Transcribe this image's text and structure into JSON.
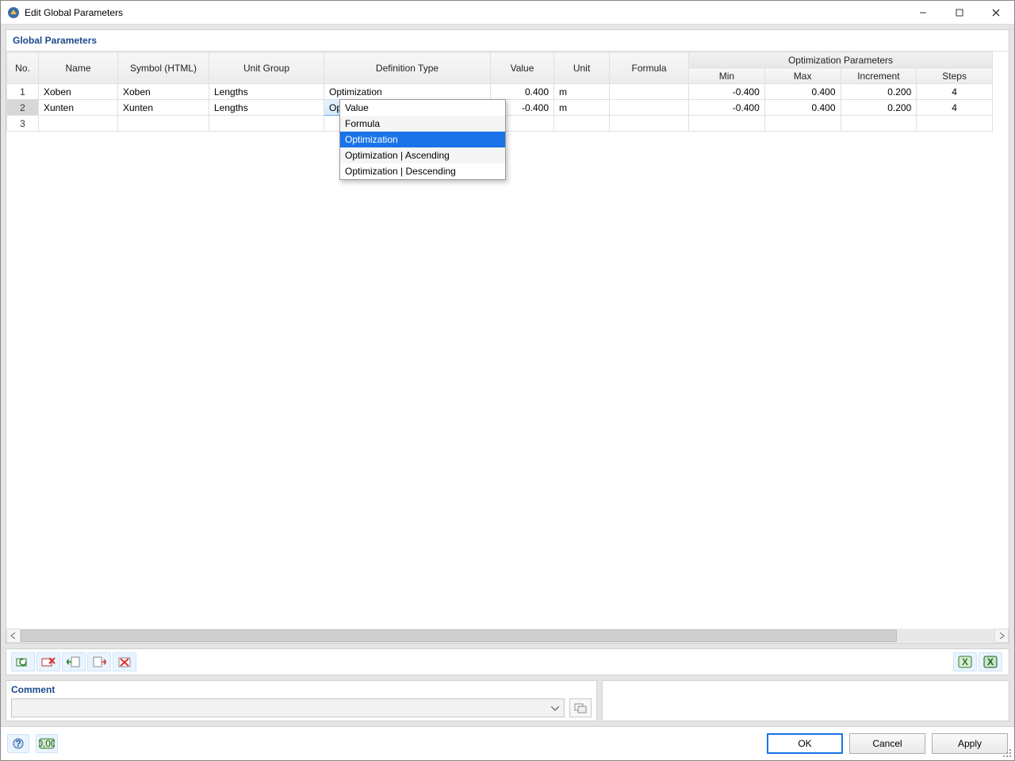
{
  "window": {
    "title": "Edit Global Parameters"
  },
  "section": {
    "title": "Global Parameters"
  },
  "columns": {
    "no": "No.",
    "name": "Name",
    "symbol": "Symbol (HTML)",
    "unit_group": "Unit Group",
    "definition_type": "Definition Type",
    "value": "Value",
    "unit": "Unit",
    "formula": "Formula",
    "opt_group": "Optimization Parameters",
    "min": "Min",
    "max": "Max",
    "increment": "Increment",
    "steps": "Steps"
  },
  "rows": [
    {
      "no": "1",
      "name": "Xoben",
      "symbol": "Xoben",
      "unit_group": "Lengths",
      "definition_type": "Optimization",
      "value": "0.400",
      "unit": "m",
      "formula": "",
      "min": "-0.400",
      "max": "0.400",
      "increment": "0.200",
      "steps": "4"
    },
    {
      "no": "2",
      "name": "Xunten",
      "symbol": "Xunten",
      "unit_group": "Lengths",
      "definition_type": "Optimization",
      "value": "-0.400",
      "unit": "m",
      "formula": "",
      "min": "-0.400",
      "max": "0.400",
      "increment": "0.200",
      "steps": "4"
    },
    {
      "no": "3",
      "name": "",
      "symbol": "",
      "unit_group": "",
      "definition_type": "",
      "value": "",
      "unit": "",
      "formula": "",
      "min": "",
      "max": "",
      "increment": "",
      "steps": ""
    }
  ],
  "dropdown": {
    "options": [
      "Value",
      "Formula",
      "Optimization",
      "Optimization | Ascending",
      "Optimization | Descending"
    ],
    "selected_index": 2
  },
  "comment": {
    "title": "Comment",
    "value": ""
  },
  "buttons": {
    "ok": "OK",
    "cancel": "Cancel",
    "apply": "Apply"
  },
  "icons": {
    "toolbar": [
      "row-restore",
      "row-delete",
      "col-shift-left",
      "col-shift-right",
      "clear-all"
    ],
    "export": [
      "export-excel",
      "import-excel"
    ],
    "footer": [
      "help",
      "units"
    ]
  }
}
